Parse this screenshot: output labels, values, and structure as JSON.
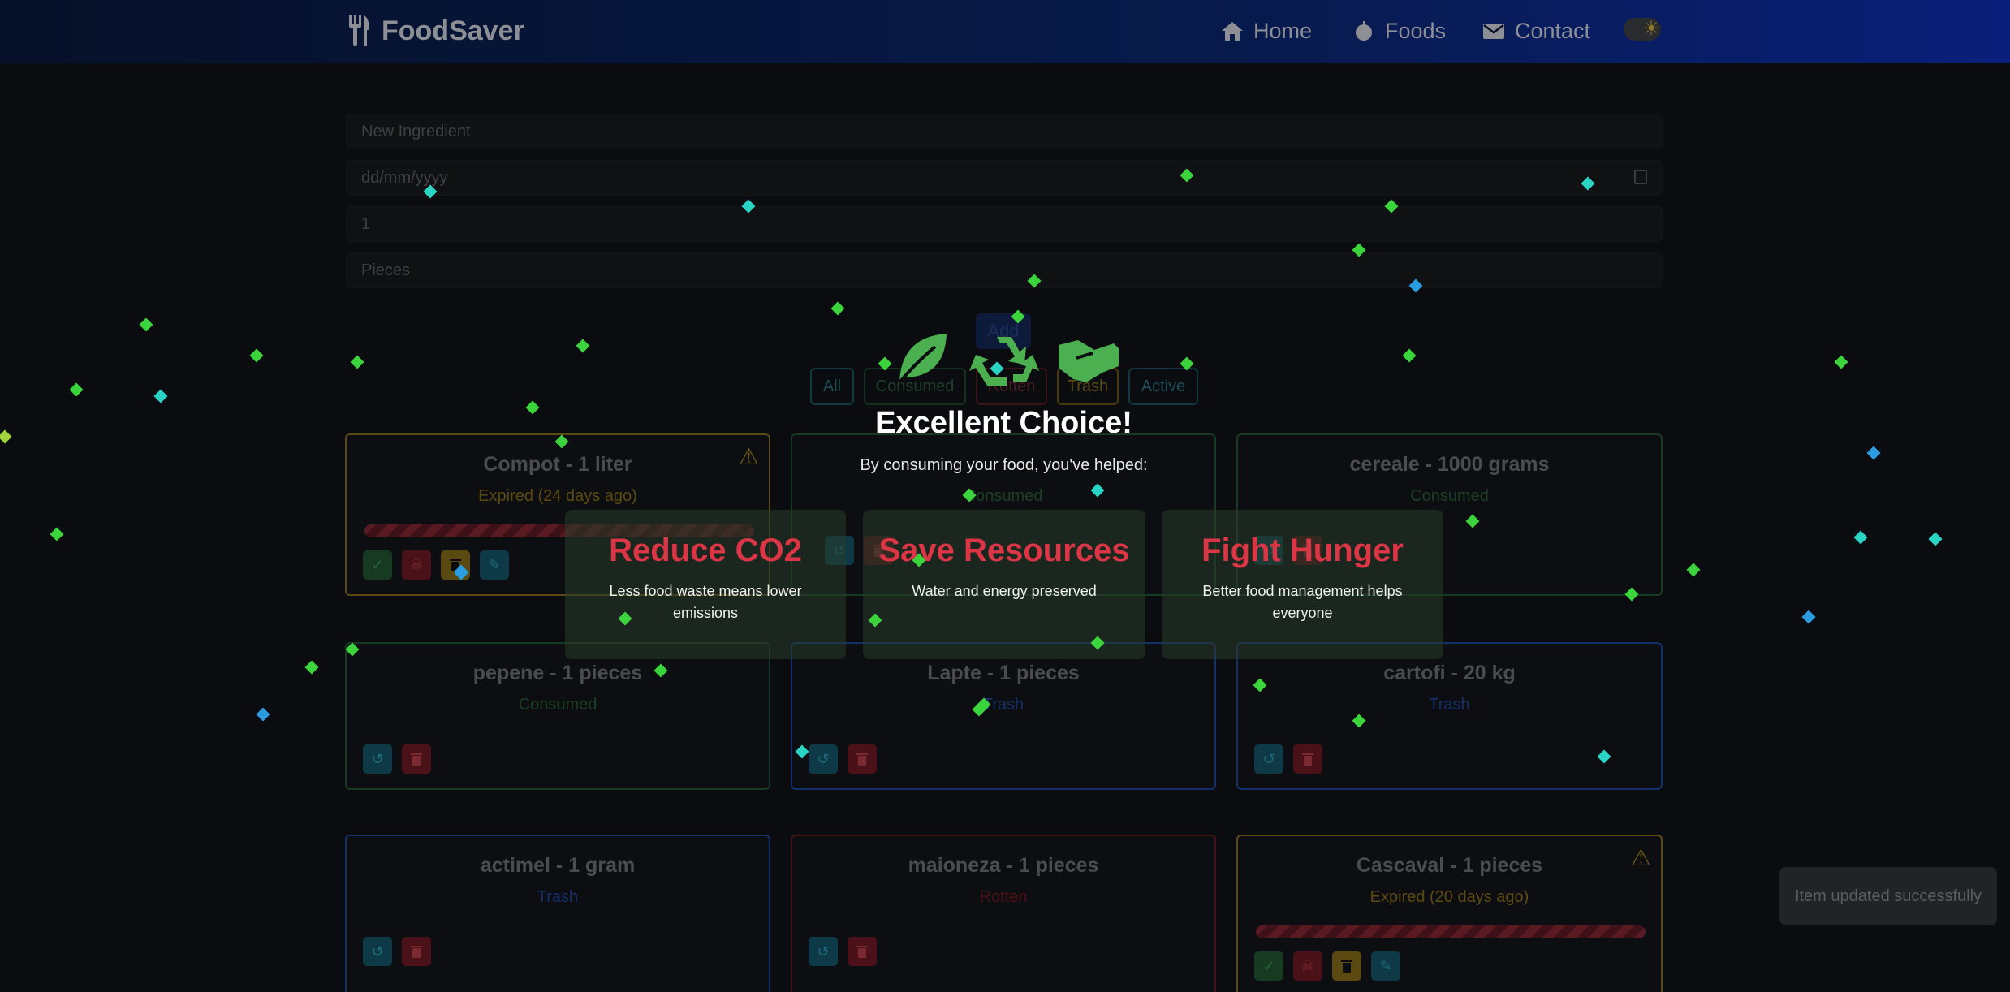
{
  "brand": {
    "name": "FoodSaver"
  },
  "nav": {
    "home": "Home",
    "foods": "Foods",
    "contact": "Contact"
  },
  "form": {
    "ingredient_placeholder": "New Ingredient",
    "date_placeholder": "dd/mm/yyyy",
    "quantity_value": "1",
    "unit_value": "Pieces",
    "add_label": "Add"
  },
  "filters": {
    "all": "All",
    "consumed": "Consumed",
    "rotten": "Rotten",
    "trash": "Trash",
    "active": "Active"
  },
  "cards": [
    {
      "title": "Compot - 1 liter",
      "status": "Expired (24 days ago)",
      "kind": "expired"
    },
    {
      "title": "",
      "status": "Consumed",
      "kind": "consumed"
    },
    {
      "title": "cereale - 1000 grams",
      "status": "Consumed",
      "kind": "consumed"
    },
    {
      "title": "pepene - 1 pieces",
      "status": "Consumed",
      "kind": "consumed"
    },
    {
      "title": "Lapte - 1 pieces",
      "status": "Trash",
      "kind": "trash"
    },
    {
      "title": "cartofi - 20 kg",
      "status": "Trash",
      "kind": "trash"
    },
    {
      "title": "actimel - 1 gram",
      "status": "Trash",
      "kind": "trash"
    },
    {
      "title": "maioneza - 1 pieces",
      "status": "Rotten",
      "kind": "rotten"
    },
    {
      "title": "Cascaval - 1 pieces",
      "status": "Expired (20 days ago)",
      "kind": "expired"
    }
  ],
  "toast": {
    "message": "Item updated successfully"
  },
  "modal": {
    "title": "Excellent Choice!",
    "subtitle": "By consuming your food, you've helped:",
    "icons": [
      "leaf-icon",
      "recycle-icon",
      "handshake-icon"
    ],
    "benefits": [
      {
        "heading": "Reduce CO2",
        "text": "Less food waste means lower emissions"
      },
      {
        "heading": "Save Resources",
        "text": "Water and energy preserved"
      },
      {
        "heading": "Fight Hunger",
        "text": "Better food management helps everyone"
      }
    ]
  },
  "colors": {
    "accent_green": "#4caf50",
    "benefit_red": "#dc3545",
    "expired_border": "#5c4a12",
    "consumed_border": "#163a22",
    "trash_border": "#12306a",
    "rotten_border": "#4a1218"
  }
}
